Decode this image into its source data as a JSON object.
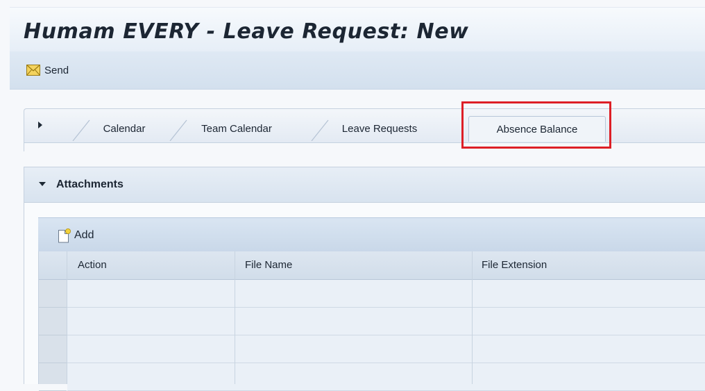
{
  "header": {
    "title": "Humam EVERY - Leave Request: New"
  },
  "toolbar": {
    "send_label": "Send",
    "send_icon": "envelope-icon"
  },
  "tabs": [
    {
      "label": "Calendar"
    },
    {
      "label": "Team Calendar"
    },
    {
      "label": "Leave Requests"
    },
    {
      "label": "Absence Balance",
      "highlighted": true
    }
  ],
  "attachments": {
    "title": "Attachments",
    "add_label": "Add",
    "add_icon": "new-document-icon",
    "columns": [
      "Action",
      "File Name",
      "File Extension"
    ],
    "rows": [
      [
        "",
        "",
        ""
      ],
      [
        "",
        "",
        ""
      ],
      [
        "",
        "",
        ""
      ],
      [
        "",
        "",
        ""
      ]
    ]
  },
  "colors": {
    "highlight": "#dd1f26",
    "header_bg": "#e6eef7",
    "toolbar_bg": "#d3e0ee"
  }
}
